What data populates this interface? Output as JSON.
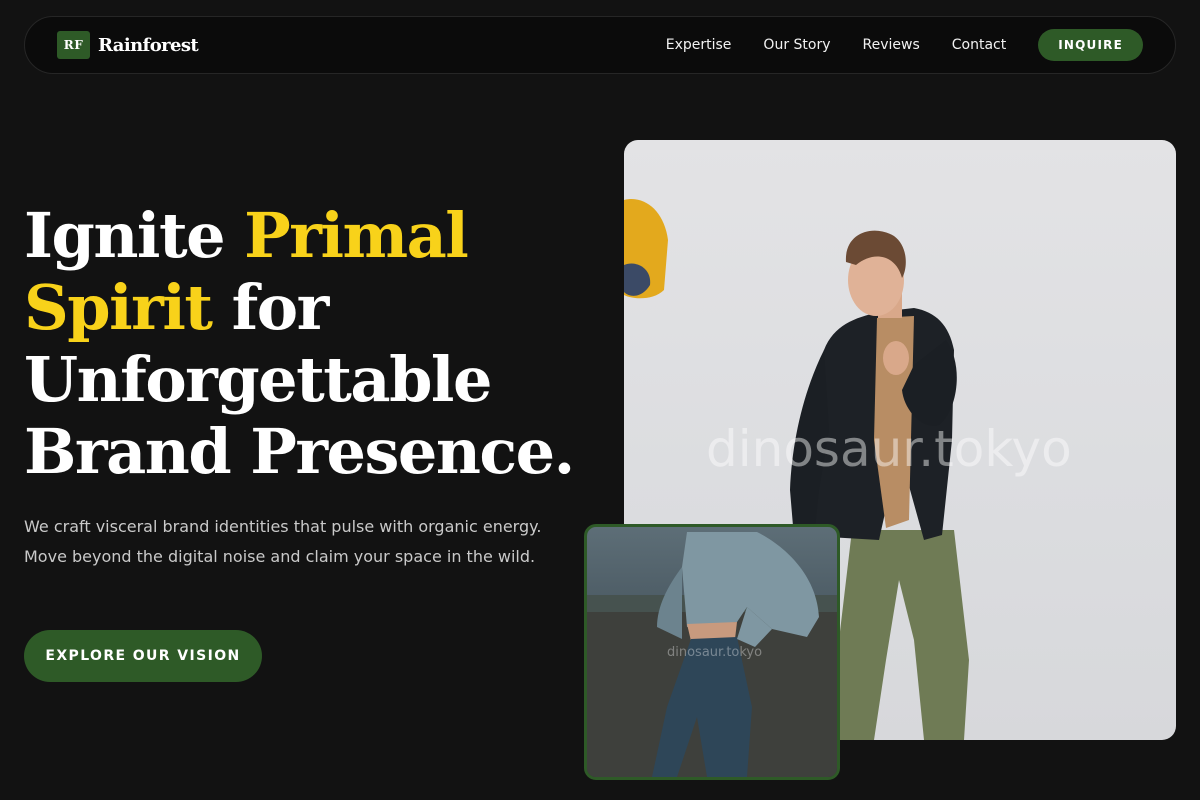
{
  "brand": {
    "mark": "RF",
    "name": "Rainforest"
  },
  "nav": {
    "links": [
      "Expertise",
      "Our Story",
      "Reviews",
      "Contact"
    ],
    "cta": "INQUIRE"
  },
  "hero": {
    "headline": {
      "part1": "Ignite ",
      "accent1": "Primal",
      "accent2": "Spirit",
      "part2": " for",
      "line3": "Unforgettable",
      "line4": "Brand Presence."
    },
    "lead": "We craft visceral brand identities that pulse with organic energy. Move beyond the digital noise and claim your space in the wild.",
    "cta": "EXPLORE OUR VISION"
  },
  "images": {
    "main_watermark": "dinosaur.tokyo",
    "inset_watermark": "dinosaur.tokyo"
  },
  "colors": {
    "background": "#121212",
    "accent_green": "#2e5a27",
    "accent_yellow": "#f8d21a"
  }
}
